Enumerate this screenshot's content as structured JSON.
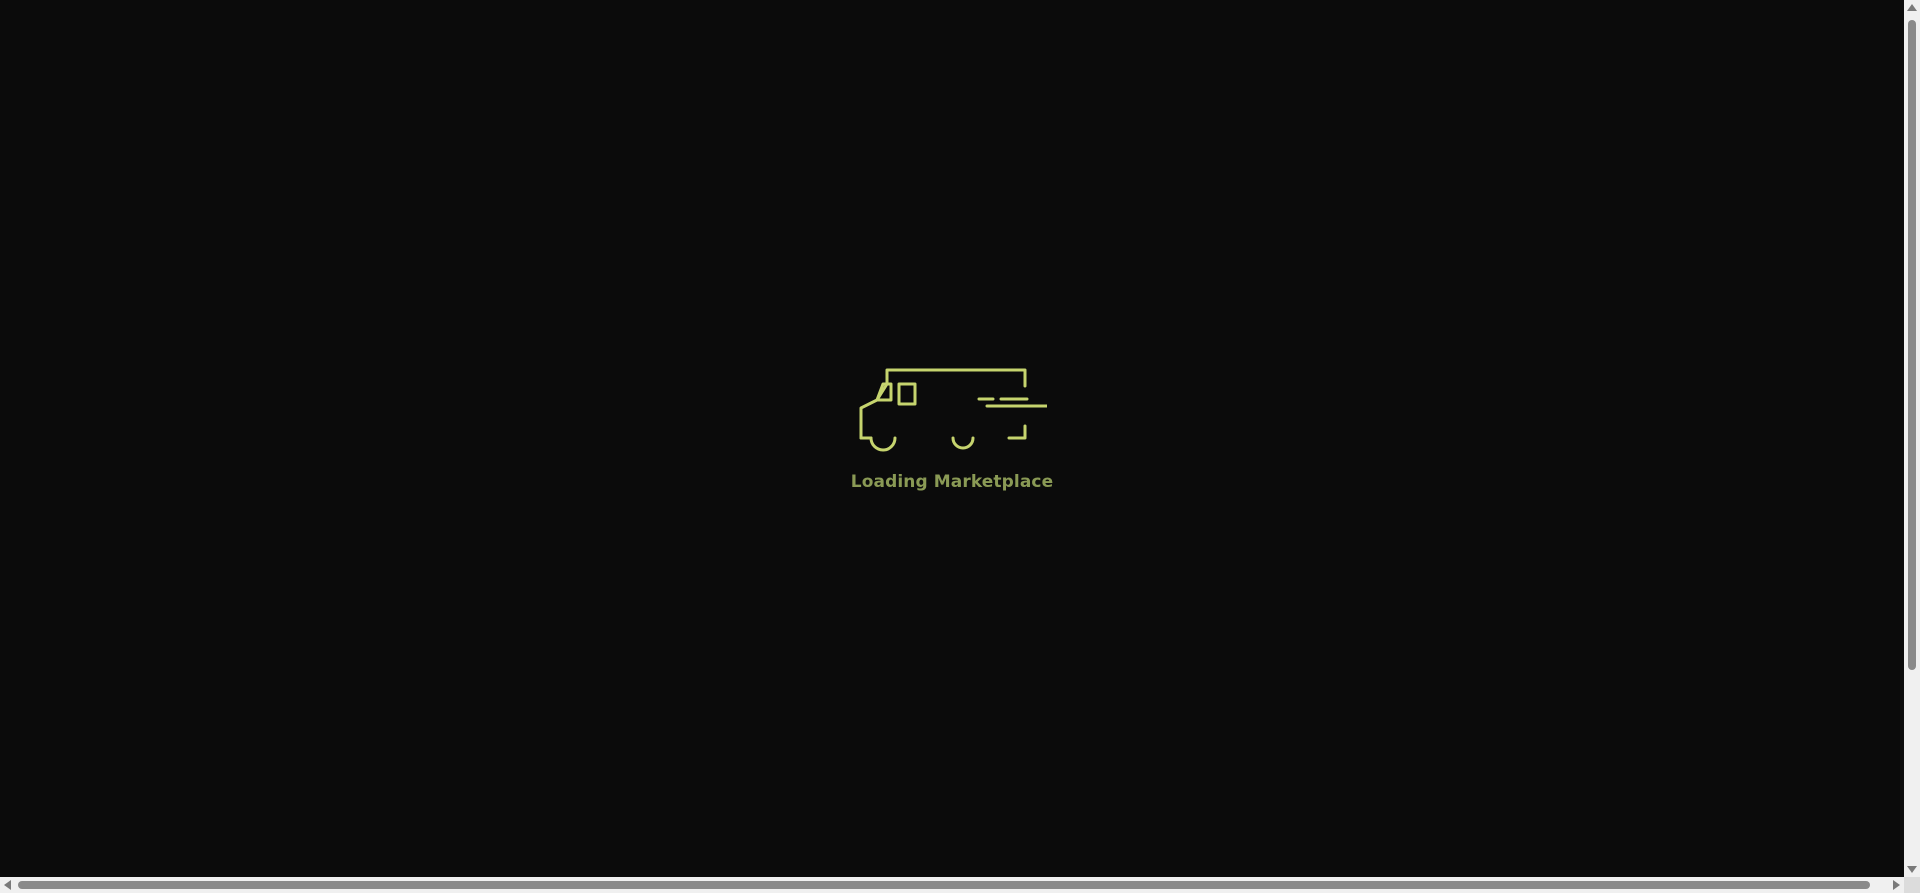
{
  "loader": {
    "text": "Loading Marketplace",
    "icon": "delivery-truck-icon"
  },
  "colors": {
    "background": "#0b0b0b",
    "accent": "#c6d46e",
    "text": "#8a9a55"
  },
  "scrollbars": {
    "vertical_icon_up": "arrow-up-icon",
    "vertical_icon_down": "arrow-down-icon",
    "horizontal_icon_left": "arrow-left-icon",
    "horizontal_icon_right": "arrow-right-icon"
  }
}
